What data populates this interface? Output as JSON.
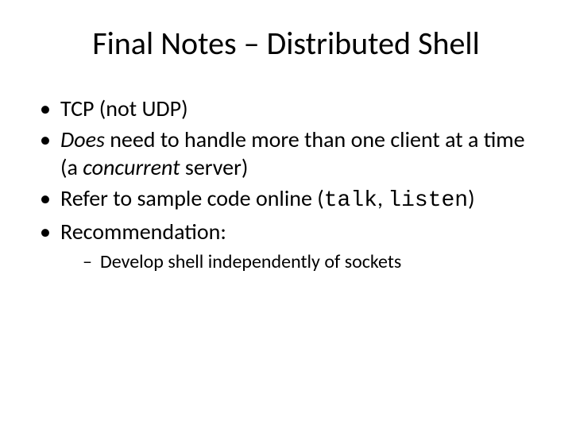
{
  "title": "Final Notes – Distributed Shell",
  "b1": {
    "t1": "TCP (not UDP)"
  },
  "b2": {
    "t1": "Does",
    "t2": " need to handle more than one client at a time (a ",
    "t3": "concurrent",
    "t4": " server)"
  },
  "b3": {
    "t1": "Refer to sample code online (",
    "t2": "talk",
    "t3": ", ",
    "t4": "listen",
    "t5": ")"
  },
  "b4": {
    "t1": "Recommendation:"
  },
  "s1": {
    "t1": "Develop shell independently of sockets"
  }
}
